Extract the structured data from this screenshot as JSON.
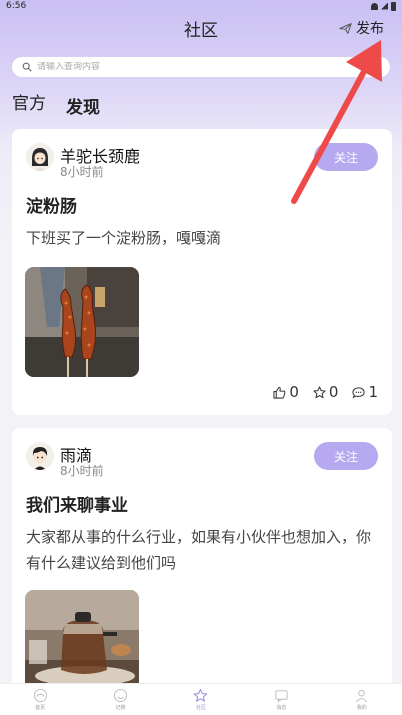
{
  "status_bar": {
    "time": "6:56"
  },
  "header": {
    "title": "社区",
    "publish_label": "发布"
  },
  "search": {
    "placeholder": "请输入查询内容"
  },
  "tabs": [
    {
      "label": "官方"
    },
    {
      "label": "发现"
    }
  ],
  "posts": [
    {
      "author": "羊驼长颈鹿",
      "time": "8小时前",
      "follow_label": "关注",
      "title": "淀粉肠",
      "body": "下班买了一个淀粉肠，嘎嘎滴",
      "likes": "0",
      "favorites": "0",
      "comments": "1"
    },
    {
      "author": "雨滴",
      "time": "8小时前",
      "follow_label": "关注",
      "title": "我们来聊事业",
      "body": "大家都从事的什么行业，如果有小伙伴也想加入，你有什么建议给到他们吗"
    }
  ],
  "bottom_nav": [
    {
      "label": "首页",
      "icon": "home-icon"
    },
    {
      "label": "记账",
      "icon": "face-icon"
    },
    {
      "label": "社区",
      "icon": "star-icon"
    },
    {
      "label": "消息",
      "icon": "message-icon"
    },
    {
      "label": "我的",
      "icon": "user-icon"
    }
  ],
  "colors": {
    "accent": "#b6a9ef",
    "annotation_arrow": "#ef4a4a"
  }
}
